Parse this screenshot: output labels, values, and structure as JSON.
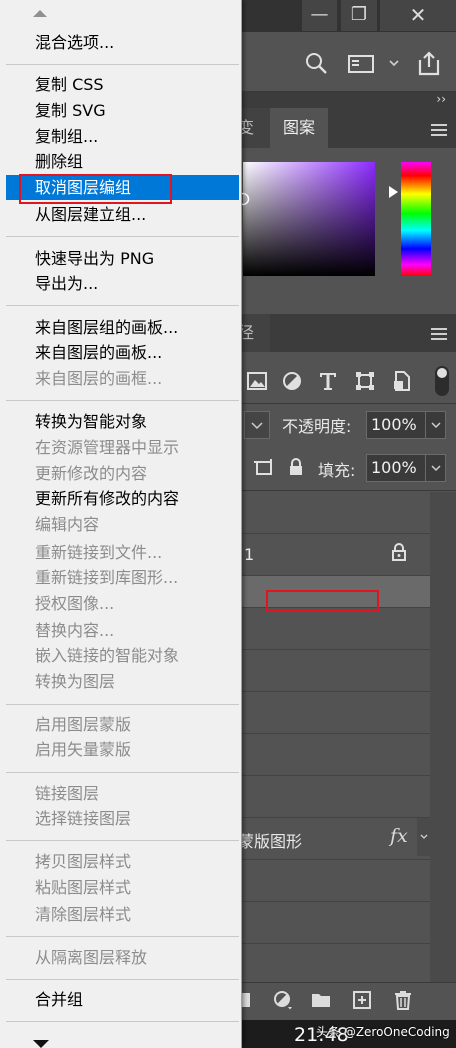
{
  "window": {
    "minimize_glyph": "—",
    "restore_glyph": "❐",
    "close_glyph": "✕"
  },
  "panels": {
    "color_tabs": [
      "変",
      "图案"
    ],
    "layers_tab": "径",
    "collapse_glyph": "››"
  },
  "layers": {
    "opacity_label": "不透明度:",
    "opacity_value": "100%",
    "fill_label": "填充:",
    "fill_value": "100%",
    "row1_label": "1",
    "row_mask_label": "蒙版图形",
    "fx_label": "fx"
  },
  "taskbar": {
    "clock": "21:48",
    "watermark": "头条 @ZeroOneCoding"
  },
  "colors": {
    "menu_highlight": "#0078d7",
    "annotation_red": "#e0151f"
  },
  "menu": {
    "items": [
      {
        "label": "混合选项...",
        "state": "enabled"
      },
      {
        "label": "复制 CSS",
        "state": "enabled"
      },
      {
        "label": "复制 SVG",
        "state": "enabled"
      },
      {
        "label": "复制组...",
        "state": "enabled"
      },
      {
        "label": "删除组",
        "state": "enabled"
      },
      {
        "label": "取消图层编组",
        "state": "highlighted"
      },
      {
        "label": "从图层建立组...",
        "state": "enabled"
      },
      {
        "label": "快速导出为 PNG",
        "state": "enabled"
      },
      {
        "label": "导出为...",
        "state": "enabled"
      },
      {
        "label": "来自图层组的画板...",
        "state": "enabled"
      },
      {
        "label": "来自图层的画板...",
        "state": "enabled"
      },
      {
        "label": "来自图层的画框...",
        "state": "disabled"
      },
      {
        "label": "转换为智能对象",
        "state": "enabled"
      },
      {
        "label": "在资源管理器中显示",
        "state": "disabled"
      },
      {
        "label": "更新修改的内容",
        "state": "disabled"
      },
      {
        "label": "更新所有修改的内容",
        "state": "enabled"
      },
      {
        "label": "编辑内容",
        "state": "disabled"
      },
      {
        "label": "重新链接到文件...",
        "state": "disabled"
      },
      {
        "label": "重新链接到库图形...",
        "state": "disabled"
      },
      {
        "label": "授权图像...",
        "state": "disabled"
      },
      {
        "label": "替换内容...",
        "state": "disabled"
      },
      {
        "label": "嵌入链接的智能对象",
        "state": "disabled"
      },
      {
        "label": "转换为图层",
        "state": "disabled"
      },
      {
        "label": "启用图层蒙版",
        "state": "disabled"
      },
      {
        "label": "启用矢量蒙版",
        "state": "disabled"
      },
      {
        "label": "链接图层",
        "state": "disabled"
      },
      {
        "label": "选择链接图层",
        "state": "disabled"
      },
      {
        "label": "拷贝图层样式",
        "state": "disabled"
      },
      {
        "label": "粘贴图层样式",
        "state": "disabled"
      },
      {
        "label": "清除图层样式",
        "state": "disabled"
      },
      {
        "label": "从隔离图层释放",
        "state": "disabled"
      },
      {
        "label": "合并组",
        "state": "enabled"
      }
    ]
  }
}
